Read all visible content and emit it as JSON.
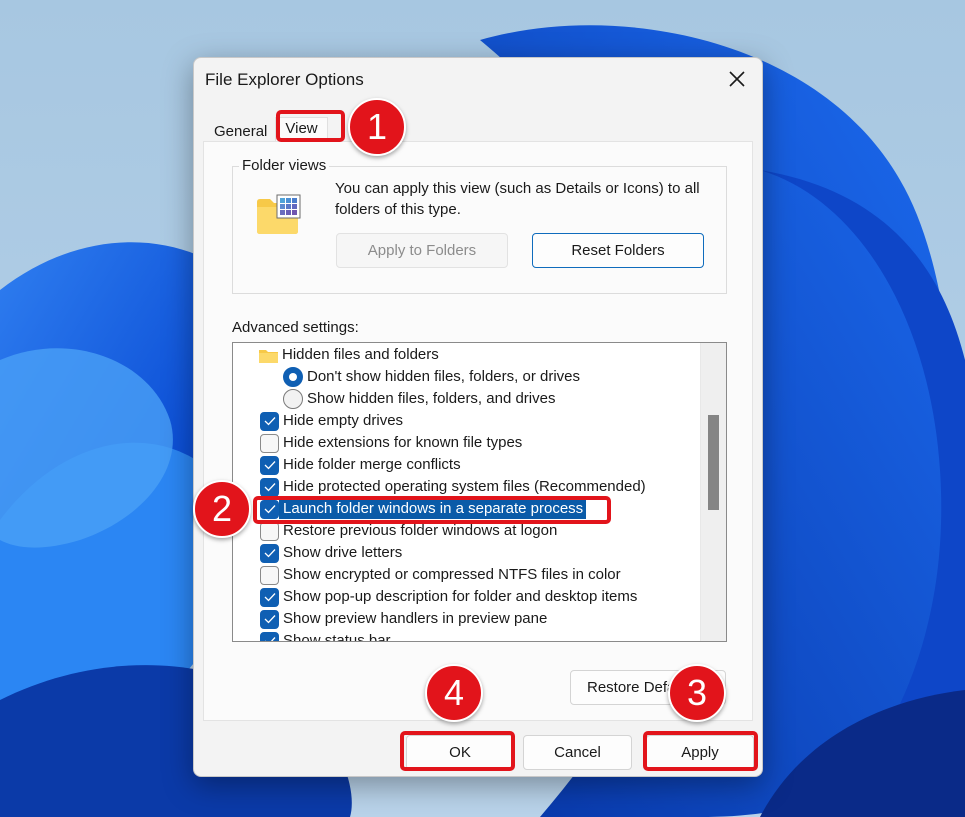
{
  "dialog": {
    "title": "File Explorer Options",
    "close_icon": "close-icon",
    "tabs": [
      {
        "label": "General",
        "active": false
      },
      {
        "label": "View",
        "active": true
      }
    ],
    "folder_views": {
      "legend": "Folder views",
      "icon": "folder-grid-icon",
      "description": "You can apply this view (such as Details or Icons) to all folders of this type.",
      "apply_button": "Apply to Folders",
      "apply_button_disabled": true,
      "reset_button": "Reset Folders"
    },
    "advanced": {
      "label": "Advanced settings:",
      "items": [
        {
          "type": "group",
          "label": "Hidden files and folders",
          "icon": "folder-icon"
        },
        {
          "type": "radio",
          "label": "Don't show hidden files, folders, or drives",
          "checked": true
        },
        {
          "type": "radio",
          "label": "Show hidden files, folders, and drives",
          "checked": false
        },
        {
          "type": "checkbox",
          "label": "Hide empty drives",
          "checked": true
        },
        {
          "type": "checkbox",
          "label": "Hide extensions for known file types",
          "checked": false
        },
        {
          "type": "checkbox",
          "label": "Hide folder merge conflicts",
          "checked": true
        },
        {
          "type": "checkbox",
          "label": "Hide protected operating system files (Recommended)",
          "checked": true
        },
        {
          "type": "checkbox",
          "label": "Launch folder windows in a separate process",
          "checked": true,
          "selected": true
        },
        {
          "type": "checkbox",
          "label": "Restore previous folder windows at logon",
          "checked": false
        },
        {
          "type": "checkbox",
          "label": "Show drive letters",
          "checked": true
        },
        {
          "type": "checkbox",
          "label": "Show encrypted or compressed NTFS files in color",
          "checked": false
        },
        {
          "type": "checkbox",
          "label": "Show pop-up description for folder and desktop items",
          "checked": true
        },
        {
          "type": "checkbox",
          "label": "Show preview handlers in preview pane",
          "checked": true
        },
        {
          "type": "checkbox",
          "label": "Show status bar",
          "checked": true
        }
      ]
    },
    "restore_defaults_button": "Restore Defaults",
    "footer": {
      "ok": "OK",
      "cancel": "Cancel",
      "apply": "Apply"
    }
  },
  "annotations": [
    {
      "number": "1",
      "target": "View tab"
    },
    {
      "number": "2",
      "target": "Launch folder windows in a separate process"
    },
    {
      "number": "3",
      "target": "Apply button"
    },
    {
      "number": "4",
      "target": "OK button"
    }
  ],
  "colors": {
    "accent": "#0f5fb3",
    "selection": "#0a5ba8",
    "annotation": "#e2141b"
  }
}
